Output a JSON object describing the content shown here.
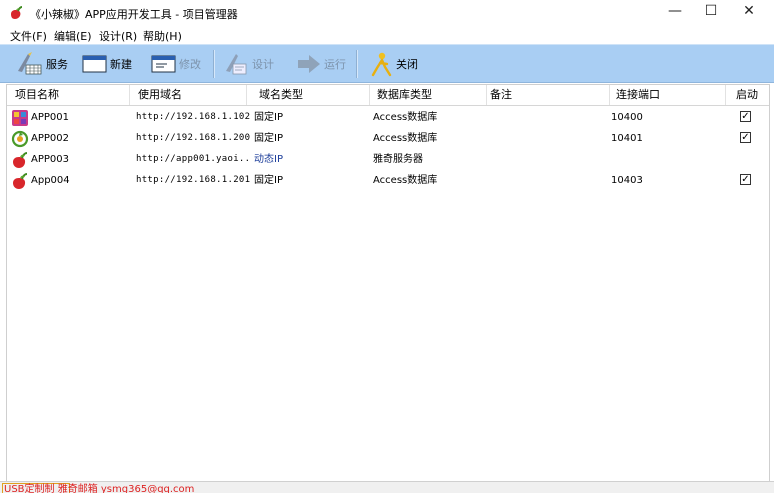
{
  "window": {
    "title": "《小辣椒》APP应用开发工具 - 项目管理器",
    "minimize_glyph": "—",
    "maximize_glyph": "☐",
    "close_glyph": "✕"
  },
  "menu": {
    "items": [
      {
        "label": "文件(F)"
      },
      {
        "label": "编辑(E)"
      },
      {
        "label": "设计(R)"
      },
      {
        "label": "帮助(H)"
      }
    ]
  },
  "toolbar": {
    "service": "服务",
    "new": "新建",
    "edit": "修改",
    "design": "设计",
    "run": "运行",
    "close": "关闭"
  },
  "table": {
    "columns": [
      "项目名称",
      "使用域名",
      "域名类型",
      "数据库类型",
      "备注",
      "连接端口",
      "启动"
    ],
    "rows": [
      {
        "name": "APP001",
        "domain": "http://192.168.1.102",
        "domain_type": "固定IP",
        "db_type": "Access数据库",
        "note": "",
        "port": "10400",
        "enabled": true,
        "icon": "grid-app-icon"
      },
      {
        "name": "APP002",
        "domain": "http://192.168.1.200",
        "domain_type": "固定IP",
        "db_type": "Access数据库",
        "note": "",
        "port": "10401",
        "enabled": true,
        "icon": "refresh-app-icon"
      },
      {
        "name": "APP003",
        "domain": "http://app001.yaoi...",
        "domain_type": "动态IP",
        "db_type": "雅奇服务器",
        "note": "",
        "port": "",
        "enabled": false,
        "icon": "pepper-app-icon"
      },
      {
        "name": "App004",
        "domain": "http://192.168.1.201",
        "domain_type": "固定IP",
        "db_type": "Access数据库",
        "note": "",
        "port": "10403",
        "enabled": true,
        "icon": "pepper-app-icon"
      }
    ]
  },
  "status": {
    "text": "USB定制制  雅奇邮箱 ysmg365@qq.com"
  },
  "colors": {
    "toolbar_bg": "#a9cef3",
    "status_text": "#dd2222",
    "dynamic_ip": "#1c3d9a"
  }
}
